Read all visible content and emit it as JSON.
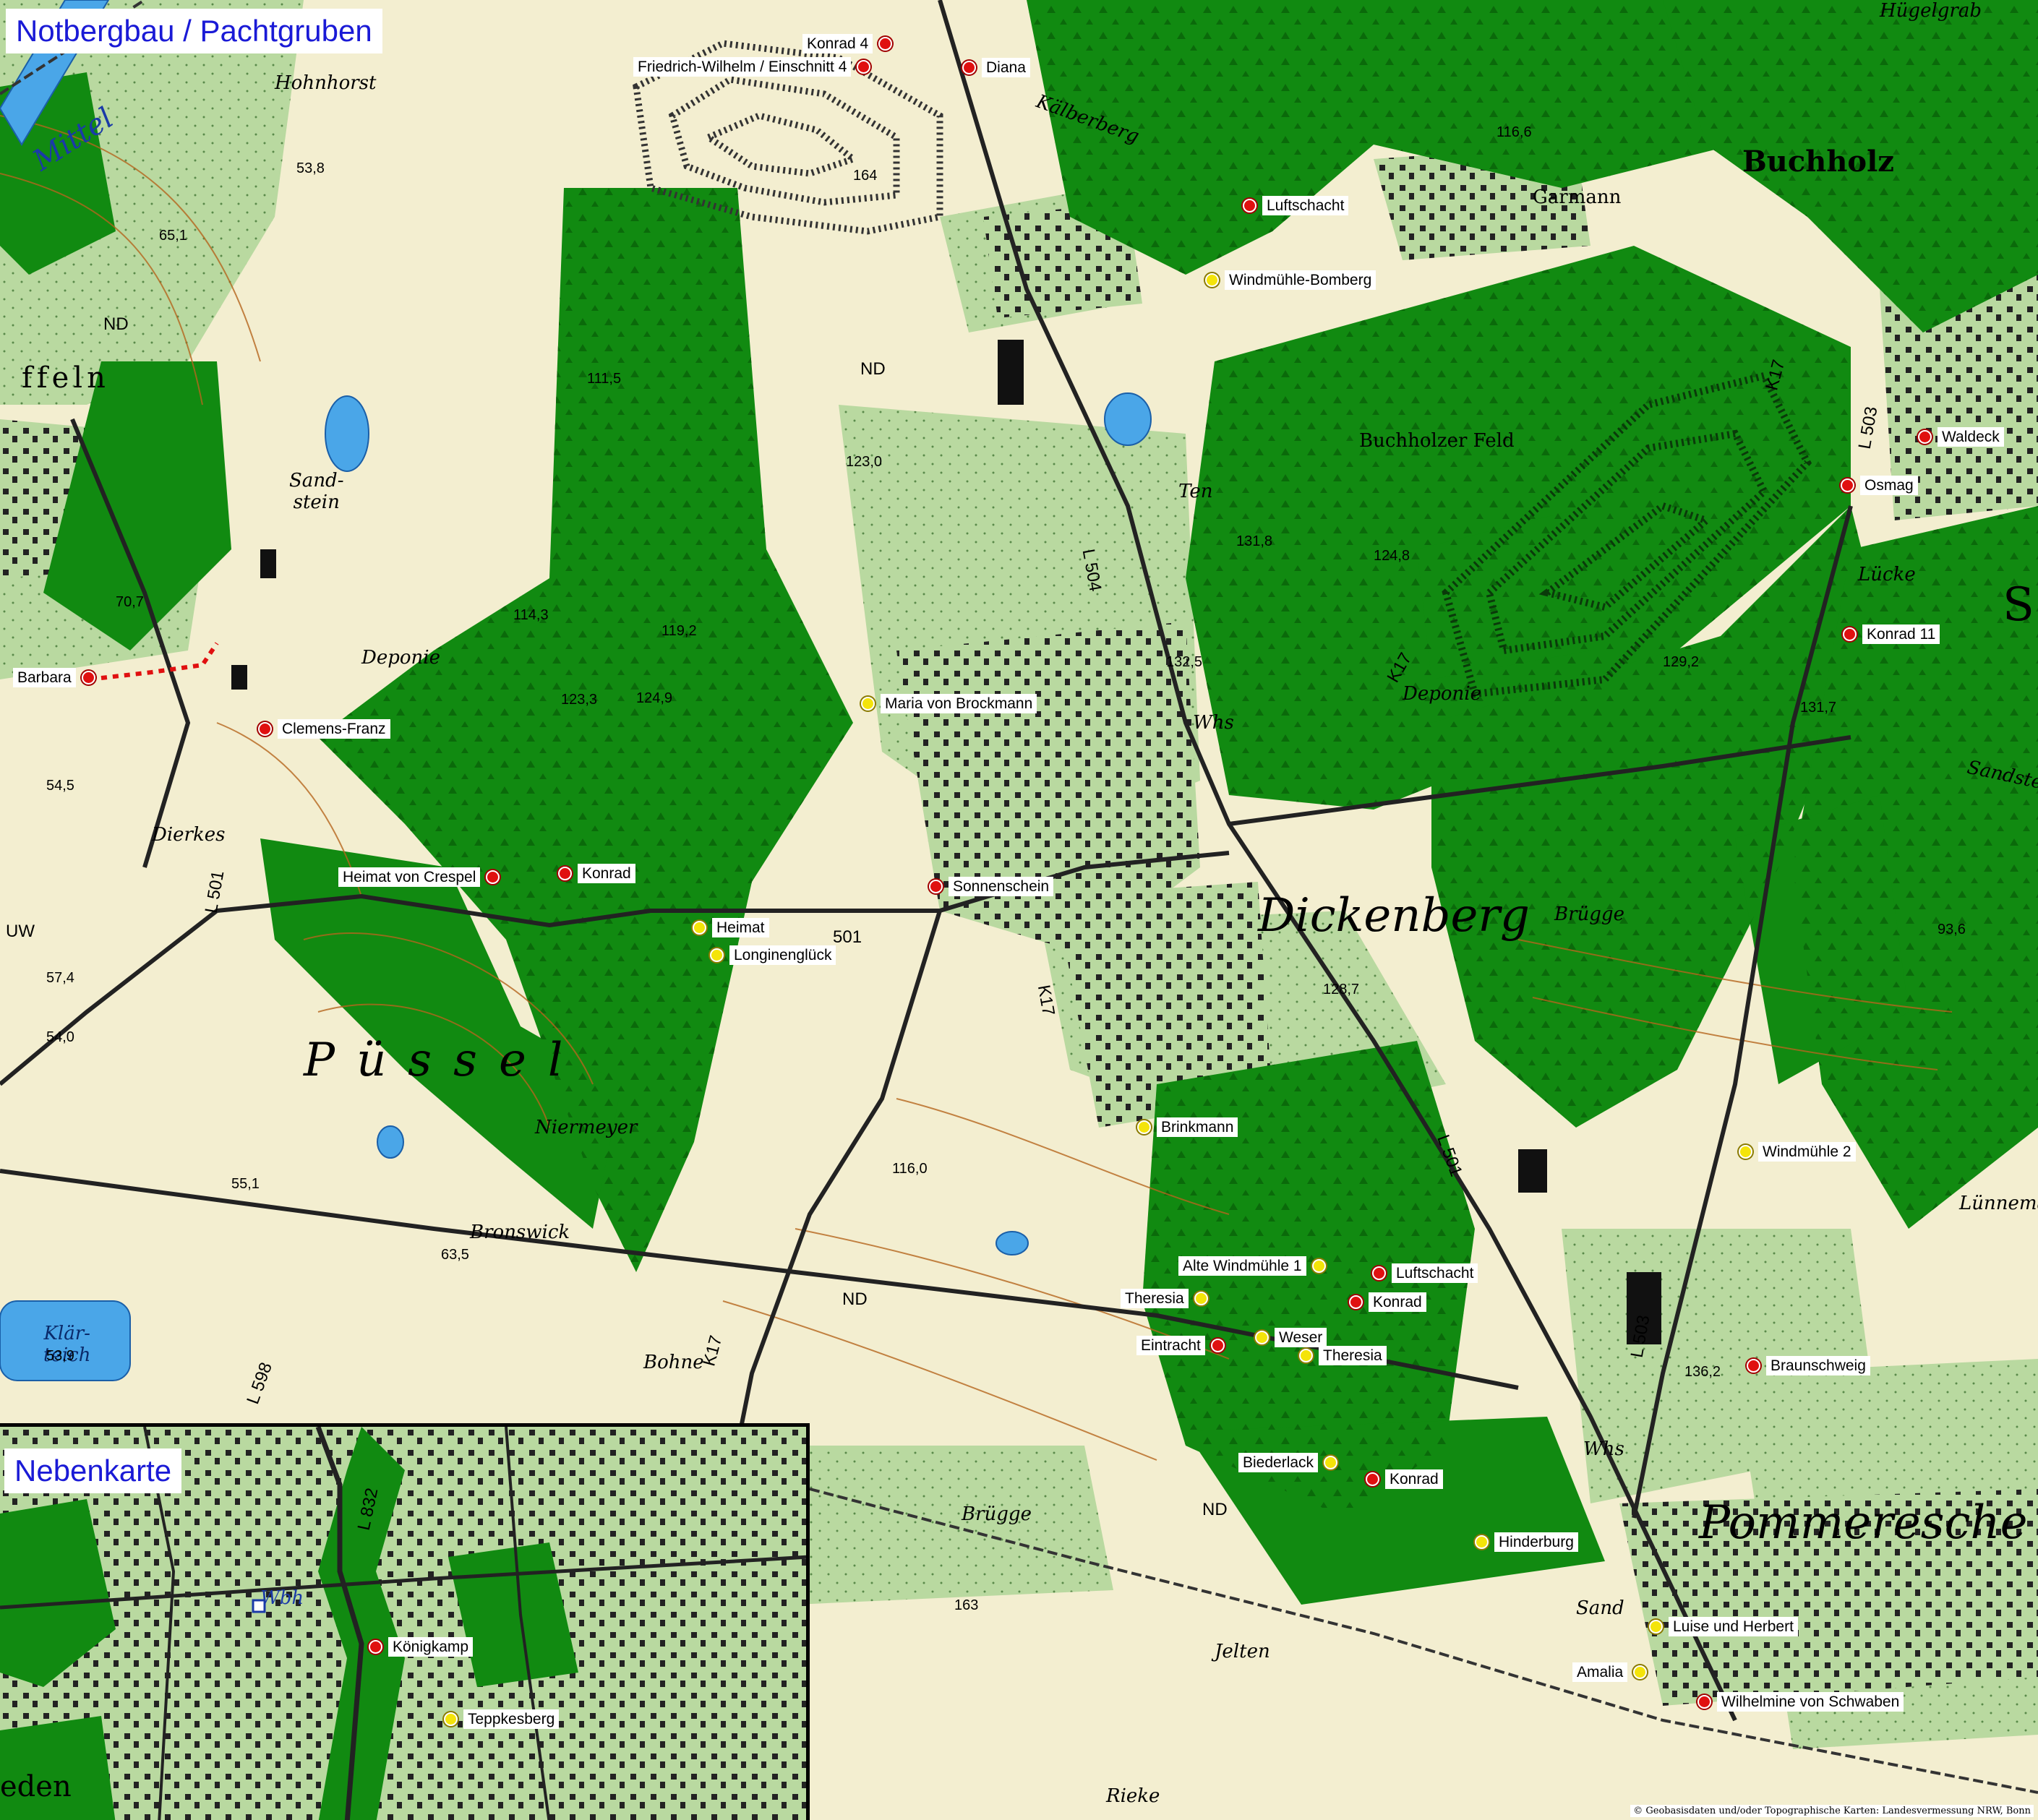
{
  "title": "Notbergbau / Pachtgruben",
  "inset_title": "Nebenkarte",
  "copyright": "© Geobasisdaten und/oder Topographische Karten: Landesvermessung NRW, Bonn",
  "marker_colors": {
    "red": "#e01010",
    "yellow": "#f4e40a"
  },
  "map_colors": {
    "forest": "#118a11",
    "meadow": "#b9d9a0",
    "field": "#f3eed0",
    "water": "#4aa6e8",
    "contour": "#b5651d"
  },
  "markers": [
    {
      "id": "konrad-4",
      "label": "Konrad 4",
      "color": "red"
    },
    {
      "id": "friedrich-wilhelm",
      "label": "Friedrich-Wilhelm / Einschnitt 4",
      "color": "red"
    },
    {
      "id": "diana",
      "label": "Diana",
      "color": "red"
    },
    {
      "id": "luftschacht-north",
      "label": "Luftschacht",
      "color": "red"
    },
    {
      "id": "windmuehle-bomberg",
      "label": "Windmühle-Bomberg",
      "color": "yellow"
    },
    {
      "id": "waldeck",
      "label": "Waldeck",
      "color": "red"
    },
    {
      "id": "osmag",
      "label": "Osmag",
      "color": "red"
    },
    {
      "id": "konrad-11",
      "label": "Konrad 11",
      "color": "red"
    },
    {
      "id": "barbara",
      "label": "Barbara",
      "color": "red"
    },
    {
      "id": "clemens-franz",
      "label": "Clemens-Franz",
      "color": "red"
    },
    {
      "id": "maria-von-brockmann",
      "label": "Maria von Brockmann",
      "color": "yellow"
    },
    {
      "id": "heimat-von-crespel",
      "label": "Heimat von Crespel",
      "color": "red"
    },
    {
      "id": "konrad-west",
      "label": "Konrad",
      "color": "red"
    },
    {
      "id": "sonnenschein",
      "label": "Sonnenschein",
      "color": "red"
    },
    {
      "id": "heimat",
      "label": "Heimat",
      "color": "yellow"
    },
    {
      "id": "longinenglueck",
      "label": "Longinenglück",
      "color": "yellow"
    },
    {
      "id": "brinkmann",
      "label": "Brinkmann",
      "color": "yellow"
    },
    {
      "id": "windmuehle-2",
      "label": "Windmühle 2",
      "color": "yellow"
    },
    {
      "id": "alte-windmuehle-1",
      "label": "Alte Windmühle 1",
      "color": "yellow"
    },
    {
      "id": "luftschacht-south",
      "label": "Luftschacht",
      "color": "red"
    },
    {
      "id": "theresia-west",
      "label": "Theresia",
      "color": "yellow"
    },
    {
      "id": "konrad-center",
      "label": "Konrad",
      "color": "red"
    },
    {
      "id": "eintracht",
      "label": "Eintracht",
      "color": "red"
    },
    {
      "id": "weser",
      "label": "Weser",
      "color": "yellow"
    },
    {
      "id": "theresia-east",
      "label": "Theresia",
      "color": "yellow"
    },
    {
      "id": "braunschweig",
      "label": "Braunschweig",
      "color": "red"
    },
    {
      "id": "biederlack",
      "label": "Biederlack",
      "color": "yellow"
    },
    {
      "id": "konrad-south",
      "label": "Konrad",
      "color": "red"
    },
    {
      "id": "hinderburg",
      "label": "Hinderburg",
      "color": "yellow"
    },
    {
      "id": "luise-und-herbert",
      "label": "Luise und Herbert",
      "color": "yellow"
    },
    {
      "id": "amalia",
      "label": "Amalia",
      "color": "yellow"
    },
    {
      "id": "wilhelmine-von-schwaben",
      "label": "Wilhelmine von Schwaben",
      "color": "red"
    }
  ],
  "inset_markers": [
    {
      "id": "koenigkamp",
      "label": "Königkamp",
      "color": "red"
    },
    {
      "id": "teppkesberg",
      "label": "Teppkesberg",
      "color": "yellow"
    }
  ],
  "places": [
    {
      "id": "dickenberg",
      "text": "Dickenberg"
    },
    {
      "id": "puessel",
      "text": "Püssel"
    },
    {
      "id": "pommeresche",
      "text": "Pommeresche"
    },
    {
      "id": "buchholz",
      "text": "Buchholz"
    },
    {
      "id": "buchholzer-feld",
      "text": "Buchholzer Feld"
    },
    {
      "id": "hohnhorst",
      "text": "Hohnhorst"
    },
    {
      "id": "kaelberberg",
      "text": "Kälberberg"
    },
    {
      "id": "garmann",
      "text": "Garmann"
    },
    {
      "id": "huegelgrab",
      "text": "Hügelgrab"
    },
    {
      "id": "sandstein-west",
      "text": "Sand-\nstein"
    },
    {
      "id": "deponie-west",
      "text": "Deponie"
    },
    {
      "id": "deponie-east",
      "text": "Deponie"
    },
    {
      "id": "sandstein-east",
      "text": "Sandstein"
    },
    {
      "id": "ffeln",
      "text": "ffeln"
    },
    {
      "id": "dierkes",
      "text": "Dierkes"
    },
    {
      "id": "niermeyer",
      "text": "Niermeyer"
    },
    {
      "id": "bronswick",
      "text": "Bronswick"
    },
    {
      "id": "bohne",
      "text": "Bohne"
    },
    {
      "id": "bruegge-north",
      "text": "Brügge"
    },
    {
      "id": "bruegge-south",
      "text": "Brügge"
    },
    {
      "id": "jelten",
      "text": "Jelten"
    },
    {
      "id": "rieke",
      "text": "Rieke"
    },
    {
      "id": "luecke",
      "text": "Lücke"
    },
    {
      "id": "luennemann",
      "text": "Lünnema"
    },
    {
      "id": "klaerteich",
      "text": "Klär-\nteich"
    },
    {
      "id": "mittelland",
      "text": "Mittel"
    },
    {
      "id": "ten",
      "text": "Ten"
    },
    {
      "id": "whs-1",
      "text": "Whs"
    },
    {
      "id": "whs-2",
      "text": "Whs"
    },
    {
      "id": "sand",
      "text": "Sand"
    },
    {
      "id": "s-edge",
      "text": "S"
    }
  ],
  "elevations": [
    {
      "id": "e1",
      "text": "53,8"
    },
    {
      "id": "e2",
      "text": "65,1"
    },
    {
      "id": "e3",
      "text": "111,5"
    },
    {
      "id": "e4",
      "text": "123,0"
    },
    {
      "id": "e5",
      "text": "116,6"
    },
    {
      "id": "e6",
      "text": "131,8"
    },
    {
      "id": "e7",
      "text": "124,8"
    },
    {
      "id": "e8",
      "text": "132,5"
    },
    {
      "id": "e9",
      "text": "129,2"
    },
    {
      "id": "e10",
      "text": "131,7"
    },
    {
      "id": "e11",
      "text": "114,3"
    },
    {
      "id": "e12",
      "text": "119,2"
    },
    {
      "id": "e13",
      "text": "124,9"
    },
    {
      "id": "e14",
      "text": "123,3"
    },
    {
      "id": "e15",
      "text": "54,5"
    },
    {
      "id": "e16",
      "text": "57,4"
    },
    {
      "id": "e17",
      "text": "54,0"
    },
    {
      "id": "e18",
      "text": "55,1"
    },
    {
      "id": "e19",
      "text": "63,5"
    },
    {
      "id": "e20",
      "text": "53,9"
    },
    {
      "id": "e21",
      "text": "116,0"
    },
    {
      "id": "e22",
      "text": "128,7"
    },
    {
      "id": "e23",
      "text": "93,6"
    },
    {
      "id": "e24",
      "text": "136,2"
    },
    {
      "id": "e25",
      "text": "164"
    },
    {
      "id": "e26",
      "text": "70,7"
    },
    {
      "id": "e27",
      "text": "163"
    }
  ],
  "roads": [
    {
      "id": "l504",
      "text": "L 504"
    },
    {
      "id": "k17-n",
      "text": "K17"
    },
    {
      "id": "k17-c",
      "text": "K17"
    },
    {
      "id": "k17-s",
      "text": "K17"
    },
    {
      "id": "k17-ne",
      "text": "K17"
    },
    {
      "id": "l501-w",
      "text": "L 501"
    },
    {
      "id": "l501-c",
      "text": "501"
    },
    {
      "id": "l501-e",
      "text": "L 501"
    },
    {
      "id": "l503-n",
      "text": "L 503"
    },
    {
      "id": "l503-s",
      "text": "L 503"
    },
    {
      "id": "l598",
      "text": "L 598"
    },
    {
      "id": "nd-1",
      "text": "ND"
    },
    {
      "id": "nd-2",
      "text": "ND"
    },
    {
      "id": "nd-3",
      "text": "ND"
    },
    {
      "id": "nd-4",
      "text": "ND"
    },
    {
      "id": "uw",
      "text": "UW"
    },
    {
      "id": "l832",
      "text": "L 832"
    },
    {
      "id": "whs-inset",
      "text": "Wbh"
    },
    {
      "id": "eden",
      "text": "eden"
    }
  ]
}
